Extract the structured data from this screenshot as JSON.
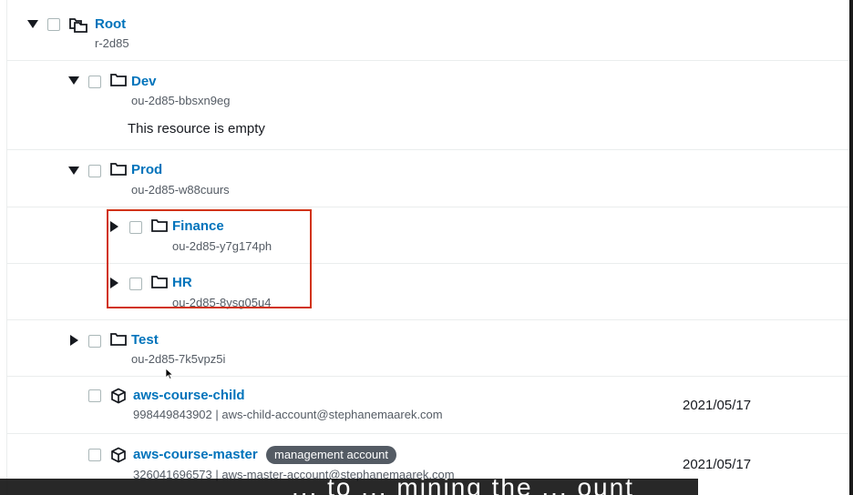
{
  "colors": {
    "link": "#0073bb",
    "text": "#16191f",
    "subtext": "#545b64",
    "highlight_border": "#d13212",
    "badge_bg": "#545b64"
  },
  "tree": {
    "root": {
      "name": "Root",
      "id": "r-2d85",
      "caret": "caret-down-icon",
      "icon": "organization-root-icon"
    },
    "dev": {
      "name": "Dev",
      "id": "ou-2d85-bbsxn9eg",
      "empty_text": "This resource is empty",
      "caret": "caret-down-icon",
      "icon": "folder-icon"
    },
    "prod": {
      "name": "Prod",
      "id": "ou-2d85-w88cuurs",
      "caret": "caret-down-icon",
      "icon": "folder-icon"
    },
    "finance": {
      "name": "Finance",
      "id": "ou-2d85-y7g174ph",
      "caret": "caret-right-icon",
      "icon": "folder-icon"
    },
    "hr": {
      "name": "HR",
      "id": "ou-2d85-8ysg05u4",
      "caret": "caret-right-icon",
      "icon": "folder-icon"
    },
    "test": {
      "name": "Test",
      "id": "ou-2d85-7k5vpz5i",
      "caret": "caret-right-icon",
      "icon": "folder-icon"
    },
    "child_account": {
      "name": "aws-course-child",
      "details": "998449843902 | aws-child-account@stephanemaarek.com",
      "date": "2021/05/17",
      "icon": "account-cube-icon"
    },
    "master_account": {
      "name": "aws-course-master",
      "badge": "management account",
      "details": "326041696573 | aws-master-account@stephanemaarek.com",
      "date": "2021/05/17",
      "icon": "account-cube-icon"
    }
  },
  "caption": {
    "text": "... to ... mining the ... ount"
  }
}
